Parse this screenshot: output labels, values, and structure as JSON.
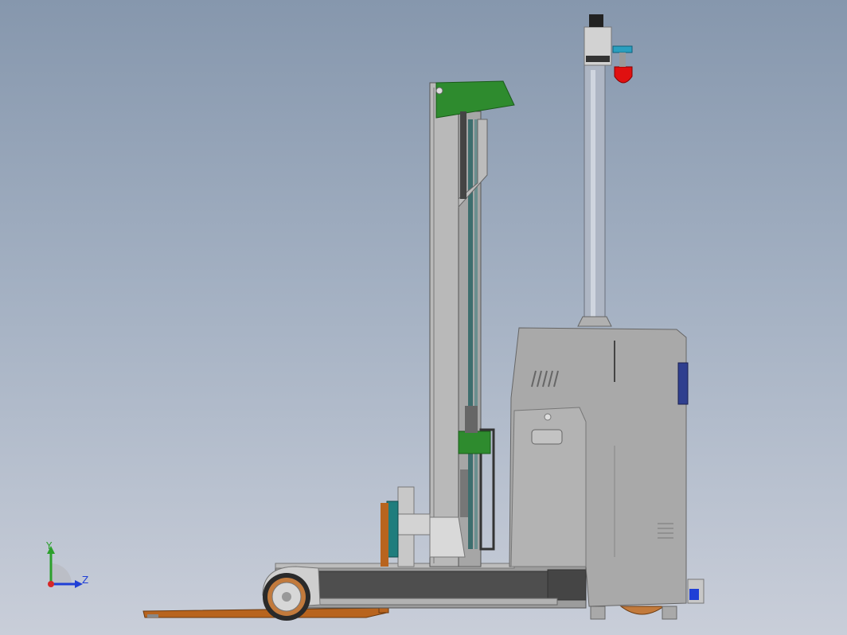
{
  "triad": {
    "y_label": "Y",
    "z_label": "Z",
    "y_color": "#2ca02c",
    "z_color": "#1f3fd6",
    "x_color": "#d62728"
  },
  "colors": {
    "body_gray": "#a9a9a9",
    "mast_gray": "#b9b9b9",
    "accent_green": "#2e8b2e",
    "fork_orange": "#b8641e",
    "beacon_red": "#e01010",
    "chassis_dark": "#4a4a4a",
    "teal": "#1f7d7d"
  }
}
